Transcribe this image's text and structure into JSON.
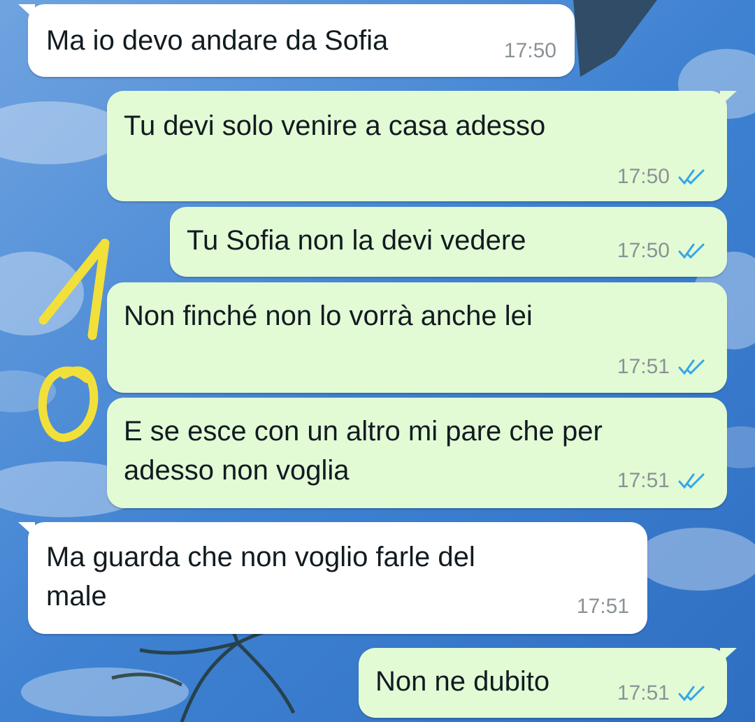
{
  "chat": {
    "messages": [
      {
        "direction": "in",
        "text": "Ma io devo andare da Sofia",
        "time": "17:50"
      },
      {
        "direction": "out",
        "text": "Tu devi solo venire a casa adesso",
        "time": "17:50",
        "status": "read"
      },
      {
        "direction": "out",
        "text": "Tu Sofia non la devi vedere",
        "time": "17:50",
        "status": "read"
      },
      {
        "direction": "out",
        "text": "Non finché non lo vorrà anche lei",
        "time": "17:51",
        "status": "read"
      },
      {
        "direction": "out",
        "text_lines": [
          "E se esce con un altro mi pare che per",
          "adesso non voglia"
        ],
        "time": "17:51",
        "status": "read"
      },
      {
        "direction": "in",
        "text_lines": [
          "Ma guarda che non voglio farle del",
          "male"
        ],
        "time": "17:51"
      },
      {
        "direction": "out",
        "text": "Non ne dubito",
        "time": "17:51",
        "status": "read"
      }
    ]
  },
  "annotation": {
    "digits": "10",
    "color": "#f2e03a"
  },
  "theme": {
    "read_tick_color": "#34a6e8",
    "outgoing_bubble": "#e3fbd5",
    "incoming_bubble": "#ffffff"
  }
}
